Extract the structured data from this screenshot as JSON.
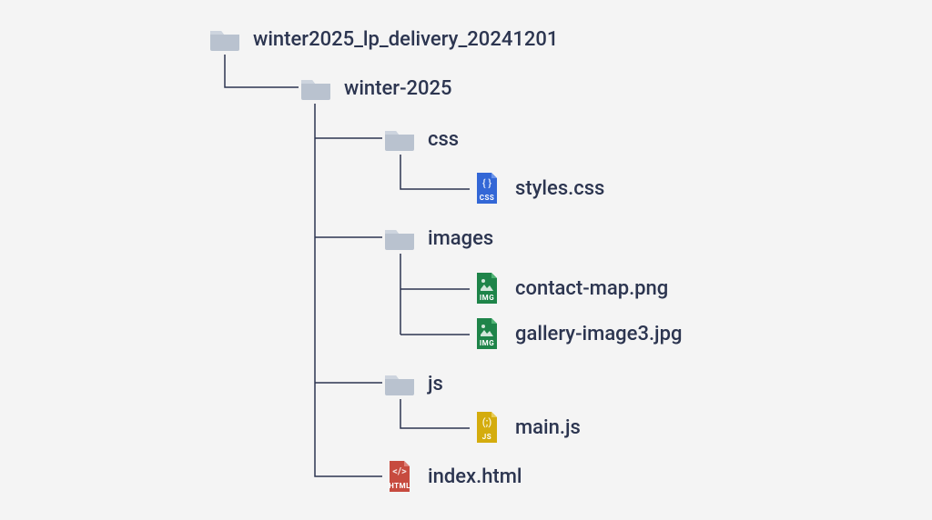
{
  "tree": {
    "root": {
      "label": "winter2025_lp_delivery_20241201",
      "children": [
        {
          "label": "winter-2025",
          "children": [
            {
              "label": "css",
              "children": [
                {
                  "label": "styles.css",
                  "filetype": "css"
                }
              ]
            },
            {
              "label": "images",
              "children": [
                {
                  "label": "contact-map.png",
                  "filetype": "img"
                },
                {
                  "label": "gallery-image3.jpg",
                  "filetype": "img"
                }
              ]
            },
            {
              "label": "js",
              "children": [
                {
                  "label": "main.js",
                  "filetype": "js"
                }
              ]
            },
            {
              "label": "index.html",
              "filetype": "html"
            }
          ]
        }
      ]
    }
  },
  "labels": {
    "root": "winter2025_lp_delivery_20241201",
    "winter2025": "winter-2025",
    "css": "css",
    "styles_css": "styles.css",
    "images": "images",
    "contact_map": "contact-map.png",
    "gallery_image3": "gallery-image3.jpg",
    "js": "js",
    "main_js": "main.js",
    "index_html": "index.html"
  },
  "filetypes": {
    "css": {
      "badge": "CSS",
      "symbol": "{ }",
      "color": "#3367d6"
    },
    "img": {
      "badge": "IMG",
      "symbol": "",
      "color": "#1e8449"
    },
    "js": {
      "badge": "JS",
      "symbol": "(;)",
      "color": "#d4ac0d"
    },
    "html": {
      "badge": "HTML",
      "symbol": "</>",
      "color": "#c74b3f"
    }
  },
  "colors": {
    "folder": "#b9c2cf",
    "text": "#2c3550",
    "line": "#2c3550"
  }
}
